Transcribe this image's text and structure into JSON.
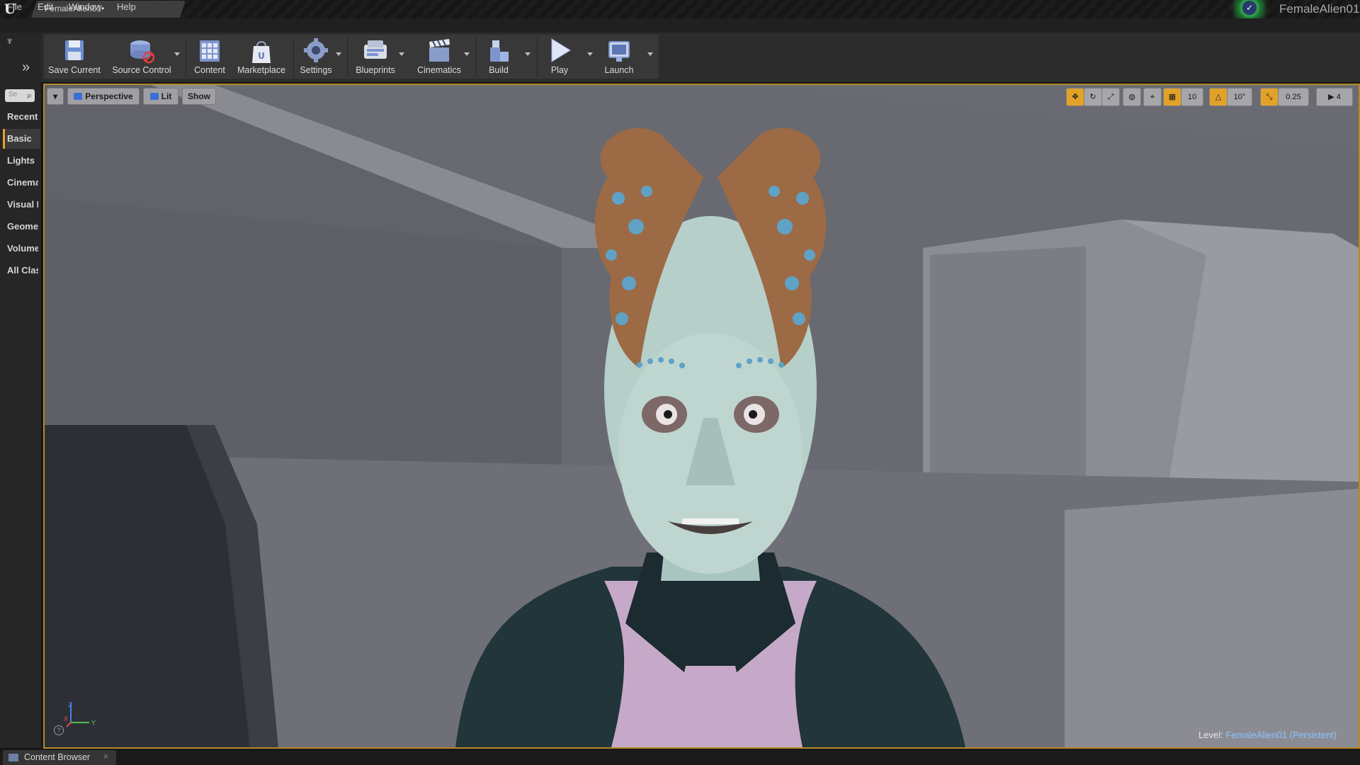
{
  "window": {
    "tab_title": "FemaleAlien01",
    "tab_dirty_marker": "•",
    "project_name": "FemaleAlien01"
  },
  "menu": [
    "File",
    "Edit",
    "Window",
    "Help"
  ],
  "toolbar": {
    "buttons": [
      {
        "label": "Save Current",
        "icon": "save-icon",
        "dropdown": false
      },
      {
        "label": "Source Control",
        "icon": "source-control-icon",
        "dropdown": true
      },
      {
        "label": "Content",
        "icon": "content-icon",
        "dropdown": false
      },
      {
        "label": "Marketplace",
        "icon": "marketplace-icon",
        "dropdown": false
      },
      {
        "label": "Settings",
        "icon": "settings-icon",
        "dropdown": true
      },
      {
        "label": "Blueprints",
        "icon": "blueprints-icon",
        "dropdown": true
      },
      {
        "label": "Cinematics",
        "icon": "cinematics-icon",
        "dropdown": true
      },
      {
        "label": "Build",
        "icon": "build-icon",
        "dropdown": true
      },
      {
        "label": "Play",
        "icon": "play-icon",
        "dropdown": true
      },
      {
        "label": "Launch",
        "icon": "launch-icon",
        "dropdown": true
      }
    ]
  },
  "place_panel": {
    "search_placeholder": "Se",
    "items": [
      "Recent",
      "Basic",
      "Lights",
      "Cinema",
      "Visual I",
      "Geome",
      "Volume",
      "All Clas"
    ],
    "selected": "Basic"
  },
  "viewport": {
    "view_mode": "Perspective",
    "lighting": "Lit",
    "show_label": "Show",
    "grid_snap_value": "10",
    "rotation_snap_value": "10°",
    "scale_snap_value": "0.25",
    "camera_speed": "4",
    "level_label": "Level:",
    "level_name": "FemaleAlien01 (Persistent)",
    "axis_x": "X",
    "axis_y": "Y",
    "axis_z": "Z"
  },
  "bottom": {
    "content_browser_tab": "Content Browser",
    "close_glyph": "×"
  },
  "colors": {
    "accent": "#e2a22a",
    "viewport_border": "#b58a23",
    "level_link": "#8ac4ff",
    "project_badge": "#2e9d4a"
  }
}
